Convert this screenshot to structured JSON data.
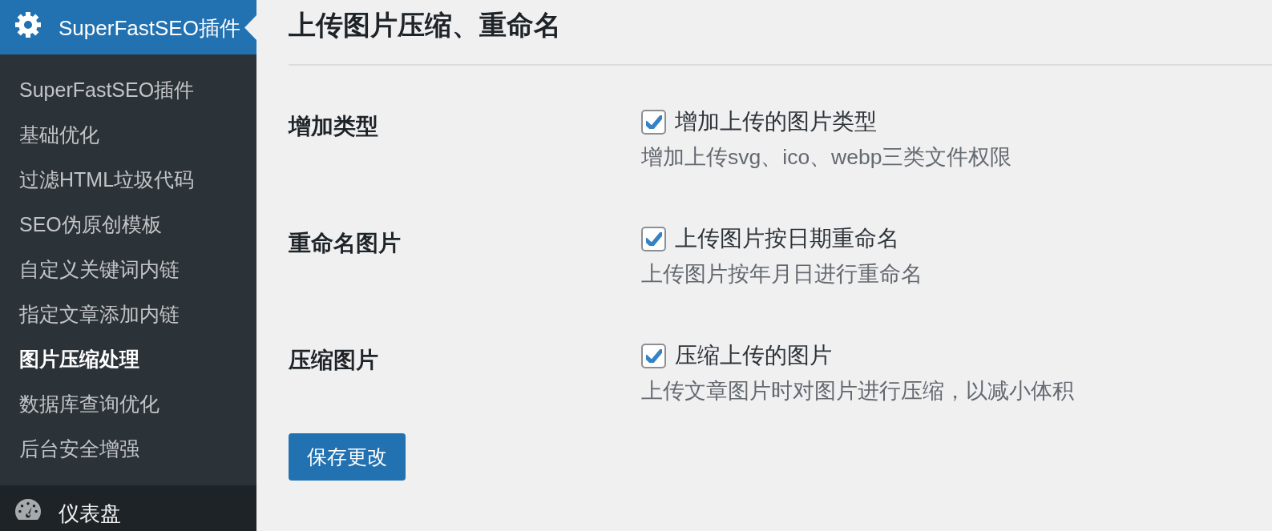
{
  "sidebar": {
    "menu": [
      {
        "kind": "settings",
        "label": "SuperFastSEO插件",
        "selected": true,
        "submenu": [
          {
            "label": "SuperFastSEO插件",
            "selected": false
          },
          {
            "label": "基础优化",
            "selected": false
          },
          {
            "label": "过滤HTML垃圾代码",
            "selected": false
          },
          {
            "label": "SEO伪原创模板",
            "selected": false
          },
          {
            "label": "自定义关键词内链",
            "selected": false
          },
          {
            "label": "指定文章添加内链",
            "selected": false
          },
          {
            "label": "图片压缩处理",
            "selected": true
          },
          {
            "label": "数据库查询优化",
            "selected": false
          },
          {
            "label": "后台安全增强",
            "selected": false
          }
        ]
      },
      {
        "kind": "dashboard",
        "label": "仪表盘",
        "selected": false
      }
    ]
  },
  "page": {
    "title": "上传图片压缩、重命名",
    "settings": [
      {
        "label": "增加类型",
        "option": "增加上传的图片类型",
        "checked": true,
        "description": "增加上传svg、ico、webp三类文件权限"
      },
      {
        "label": "重命名图片",
        "option": "上传图片按日期重命名",
        "checked": true,
        "description": "上传图片按年月日进行重命名"
      },
      {
        "label": "压缩图片",
        "option": "压缩上传的图片",
        "checked": true,
        "description": "上传文章图片时对图片进行压缩，以减小体积"
      }
    ],
    "save_button": "保存更改"
  }
}
